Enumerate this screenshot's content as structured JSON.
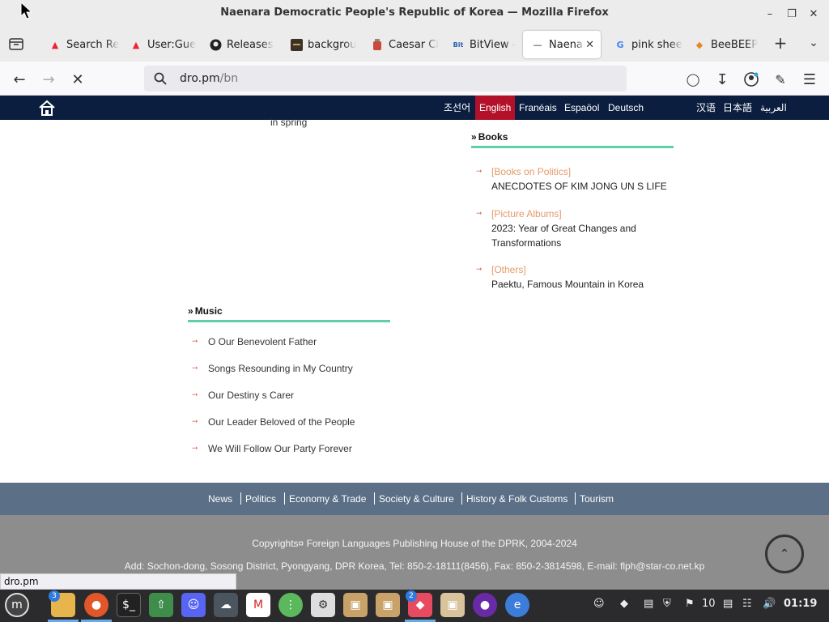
{
  "window": {
    "title": "Naenara Democratic People's Republic of Korea — Mozilla Firefox"
  },
  "tabs": [
    {
      "label": "Search Re",
      "icon": "flame-icon",
      "active": false
    },
    {
      "label": "User:Gue",
      "icon": "flame-icon",
      "active": false
    },
    {
      "label": "Releases",
      "icon": "github-icon",
      "active": false
    },
    {
      "label": "backgrou",
      "icon": "terminal-icon",
      "active": false
    },
    {
      "label": "Caesar Ci",
      "icon": "jar-icon",
      "active": false
    },
    {
      "label": "BitView -",
      "icon": "bitview-icon",
      "active": false
    },
    {
      "label": "Naenar",
      "icon": "dash-icon",
      "active": true
    },
    {
      "label": "pink shee",
      "icon": "google-icon",
      "active": false
    },
    {
      "label": "BeeBEEP",
      "icon": "beebeep-icon",
      "active": false
    }
  ],
  "navbar": {
    "url_host": "dro.pm",
    "url_path": "/bn"
  },
  "site": {
    "languages_left": [
      "조선어",
      "English",
      "Franéais",
      "Espaöol",
      "Deutsch"
    ],
    "languages_right": [
      "汉语",
      "日本語",
      "العربية"
    ],
    "active_language": "English"
  },
  "content": {
    "spring_text": "in spring",
    "books": {
      "heading": "Books",
      "items": [
        {
          "category": "[Books on Politics]",
          "title": "ANECDOTES OF KIM JONG UN S LIFE"
        },
        {
          "category": "[Picture Albums]",
          "title": "2023: Year of Great Changes and Transformations"
        },
        {
          "category": "[Others]",
          "title": "Paektu, Famous Mountain in Korea"
        }
      ]
    },
    "music": {
      "heading": "Music",
      "items": [
        "O Our Benevolent Father",
        "Songs Resounding in My Country",
        "Our Destiny s Carer",
        "Our Leader Beloved of the People",
        "We Will Follow Our Party Forever"
      ]
    }
  },
  "footer": {
    "nav": [
      "News",
      "Politics",
      "Economy & Trade",
      "Society & Culture",
      "History & Folk Customs",
      "Tourism"
    ],
    "copyright": "Copyrights¤  Foreign Languages Publishing House of the DPRK, 2004-2024",
    "address": "Add: Sochon-dong, Sosong District, Pyongyang, DPR Korea, Tel: 850-2-18111(8456), Fax: 850-2-3814598, E-mail: flph@star-co.net.kp"
  },
  "status_url": "dro.pm",
  "taskbar": {
    "files_badge": "3",
    "beebeep_badge": "2",
    "tray_number": "10",
    "clock": "01:19"
  },
  "colors": {
    "header_bg": "#0b1e3f",
    "active_lang": "#b3102a",
    "section_line": "#5fcfa9",
    "category": "#e49a6a",
    "footer_nav": "#5b6f87",
    "footer_info": "#8d8d8d"
  }
}
